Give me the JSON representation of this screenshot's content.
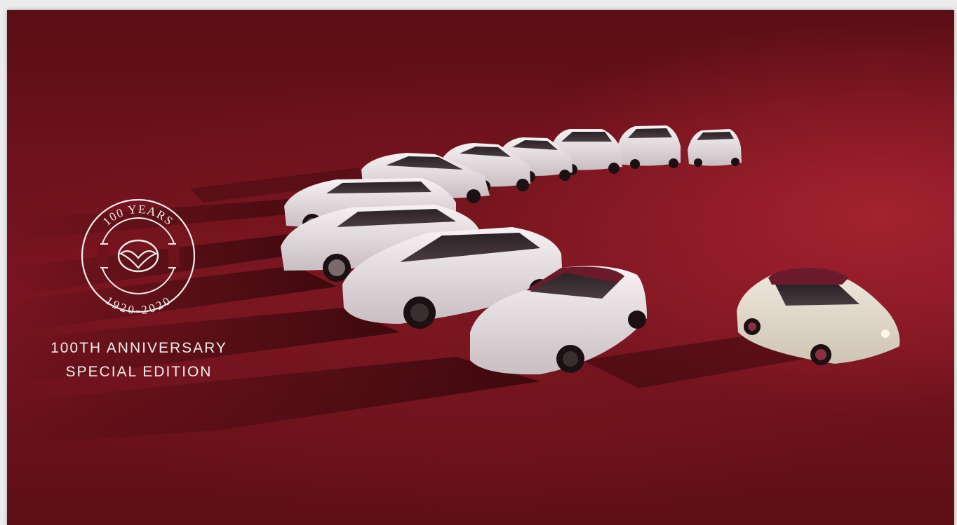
{
  "colors": {
    "backdrop": "#6e121b",
    "accent_red": "#a3222f",
    "car_body": "#e9e2e4",
    "roof_burgundy": "#6a1a2a",
    "text": "#f3ecec"
  },
  "emblem": {
    "top_text": "100 YEARS",
    "bottom_text": "1920-2020",
    "icon": "mazda-wing-logo-icon"
  },
  "headline": {
    "line1": "100TH ANNIVERSARY",
    "line2": "SPECIAL EDITION"
  }
}
